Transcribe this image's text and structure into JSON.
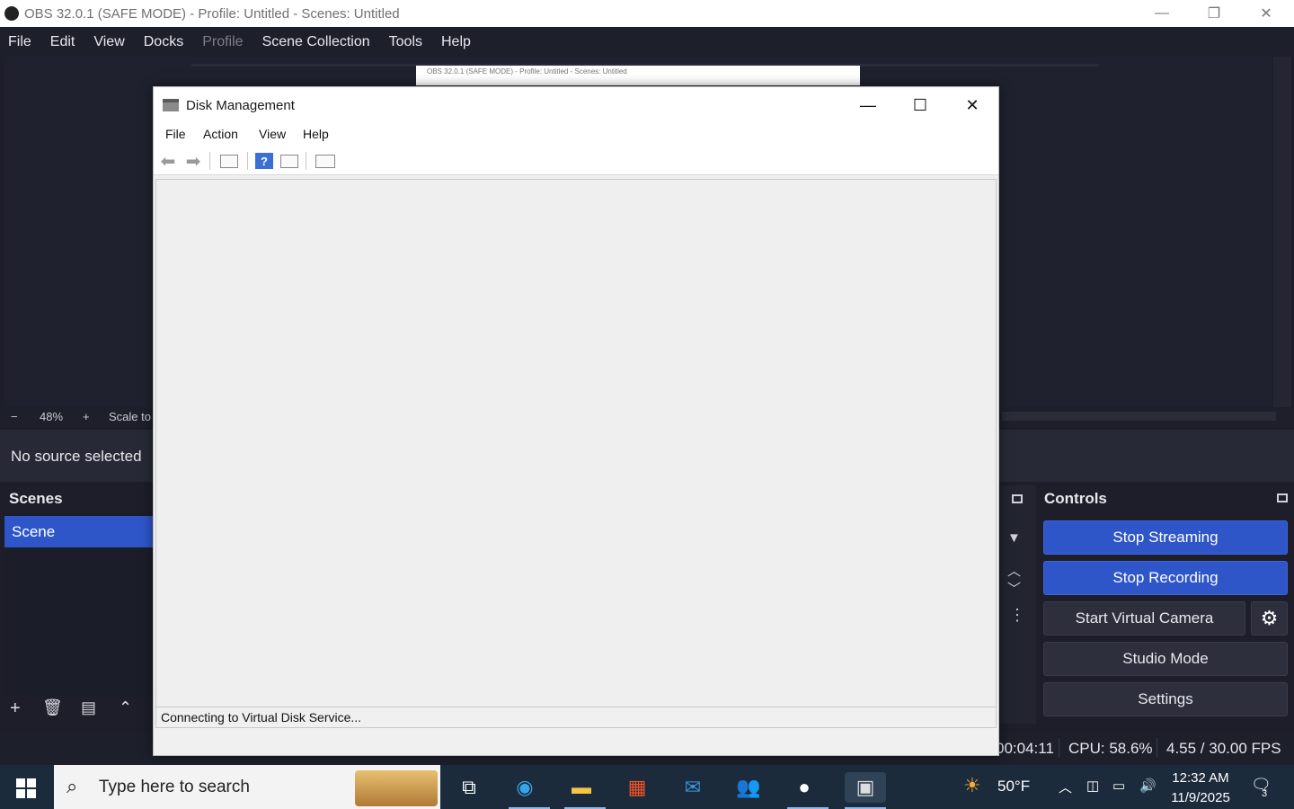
{
  "obs": {
    "title": "OBS 32.0.1 (SAFE MODE) - Profile: Untitled - Scenes: Untitled",
    "menu": [
      "File",
      "Edit",
      "View",
      "Docks",
      "Profile",
      "Scene Collection",
      "Tools",
      "Help"
    ],
    "preview_thumb_text": "OBS 32.0.1 (SAFE MODE) - Profile: Untitled - Scenes: Untitled",
    "zoom": {
      "minus": "−",
      "value": "48%",
      "plus": "+",
      "scale_label": "Scale to"
    },
    "no_source": "No source selected",
    "scenes": {
      "title": "Scenes",
      "items": [
        "Scene"
      ]
    },
    "controls": {
      "title": "Controls",
      "stop_streaming": "Stop Streaming",
      "stop_recording": "Stop Recording",
      "start_virtual_camera": "Start Virtual Camera",
      "studio_mode": "Studio Mode",
      "settings": "Settings"
    },
    "status": {
      "time": "00:04:11",
      "cpu": "CPU: 58.6%",
      "fps": "4.55 / 30.00 FPS"
    },
    "accent_color": "#2f56c9"
  },
  "disk_management": {
    "title": "Disk Management",
    "menu": [
      "File",
      "Action",
      "View",
      "Help"
    ],
    "status": "Connecting to Virtual Disk Service..."
  },
  "taskbar": {
    "search_placeholder": "Type here to search",
    "weather": "50°F",
    "time": "12:32 AM",
    "date": "11/9/2025",
    "notification_count": "3"
  }
}
